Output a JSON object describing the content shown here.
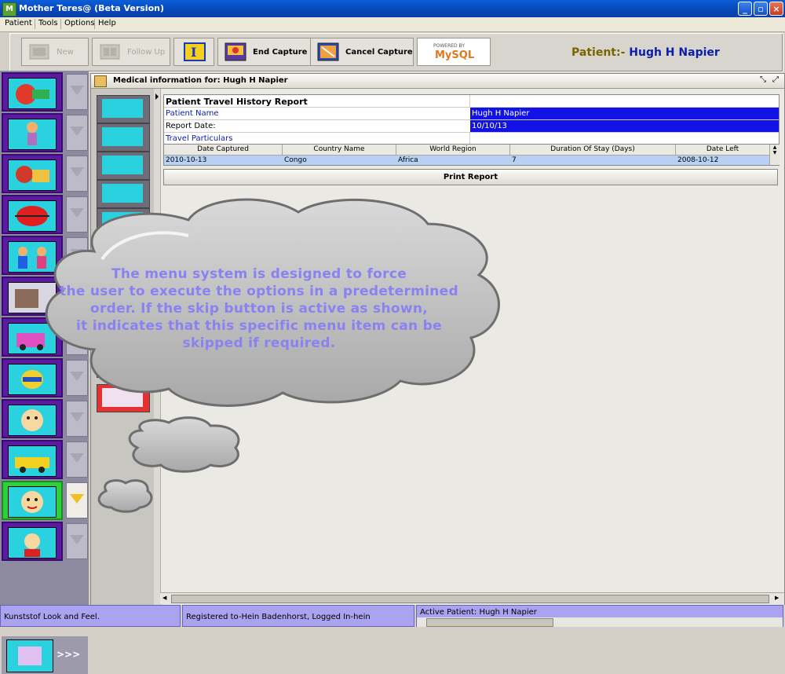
{
  "window": {
    "title": "Mother Teres@ (Beta Version)",
    "icon_letter": "M"
  },
  "menu": [
    "Patient",
    "Tools",
    "Options",
    "Help"
  ],
  "toolbar": {
    "new_label": "New",
    "followup_label": "Follow Up",
    "end_capture_label": "End Capture",
    "cancel_capture_label": "Cancel Capture",
    "mysql_powered": "POWERED BY",
    "mysql_label": "MySQL"
  },
  "patient_banner": {
    "key": "Patient:-",
    "name": "Hugh H Napier"
  },
  "nav": {
    "more_label": ">>>"
  },
  "internal_frame": {
    "title": "Medical information for: Hugh H Napier"
  },
  "report": {
    "title": "Patient Travel History Report",
    "rows": [
      {
        "label": "Patient Name",
        "value": "Hugh H Napier"
      },
      {
        "label": "Report Date:",
        "value": "10/10/13"
      },
      {
        "label": "Travel Particulars",
        "value": ""
      }
    ],
    "columns": [
      "Date Captured",
      "Country Name",
      "World Region",
      "Duration Of Stay (Days)",
      "Date Left"
    ],
    "table_rows": [
      [
        "2010-10-13",
        "Congo",
        "Africa",
        "7",
        "2008-10-12"
      ]
    ],
    "print_label": "Print Report"
  },
  "callout": {
    "lines": [
      "The menu system is designed to force",
      "the user to execute the options in a predetermined",
      "order. If the skip button is active as shown,",
      "it indicates that this specific menu item can be",
      "skipped if required."
    ]
  },
  "status": {
    "laf": "Kunststof Look and Feel.",
    "registered": "Registered to-Hein Badenhorst, Logged In-hein",
    "active_patient": "Active Patient: Hugh H Napier"
  },
  "colors": {
    "accent_blue": "#1212e6",
    "banner_name": "#0a1ea8",
    "banner_key": "#7a6400",
    "nav_purple": "#5a1ba2",
    "status_lavender": "#a9a3f0"
  }
}
